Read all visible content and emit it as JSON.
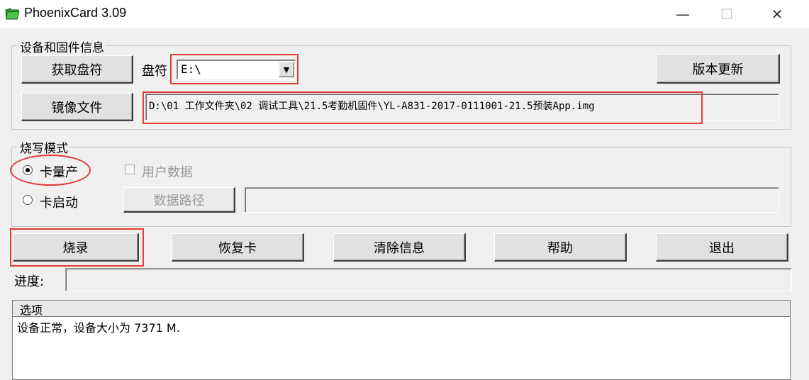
{
  "window": {
    "title": "PhoenixCard 3.09",
    "controls": [
      "—",
      "☐",
      "✕"
    ]
  },
  "device_group": {
    "title": "设备和固件信息",
    "get_drive_button": "获取盘符",
    "drive_label": "盘符",
    "drive_value": "E:\\",
    "update_button": "版本更新",
    "image_button": "镜像文件",
    "image_path": "D:\\01 工作文件夹\\02 调试工具\\21.5考勤机固件\\YL-A831-2017-0111001-21.5预装App.img"
  },
  "burn_mode": {
    "title": "烧写模式",
    "mass_production_label": "卡量产",
    "mass_production_selected": true,
    "user_data_label": "用户数据",
    "card_boot_label": "卡启动",
    "card_boot_selected": false,
    "data_path_button": "数据路径",
    "data_path_value": ""
  },
  "actions": {
    "burn": "烧录",
    "restore": "恢复卡",
    "clear": "清除信息",
    "help": "帮助",
    "exit": "退出"
  },
  "progress": {
    "label": "进度:",
    "value": 0
  },
  "log": {
    "header": "选项",
    "lines": [
      "设备正常，设备大小为 7371 M."
    ]
  },
  "colors": {
    "highlight": "#e23b3b",
    "window_bg": "#f0f0f0"
  }
}
